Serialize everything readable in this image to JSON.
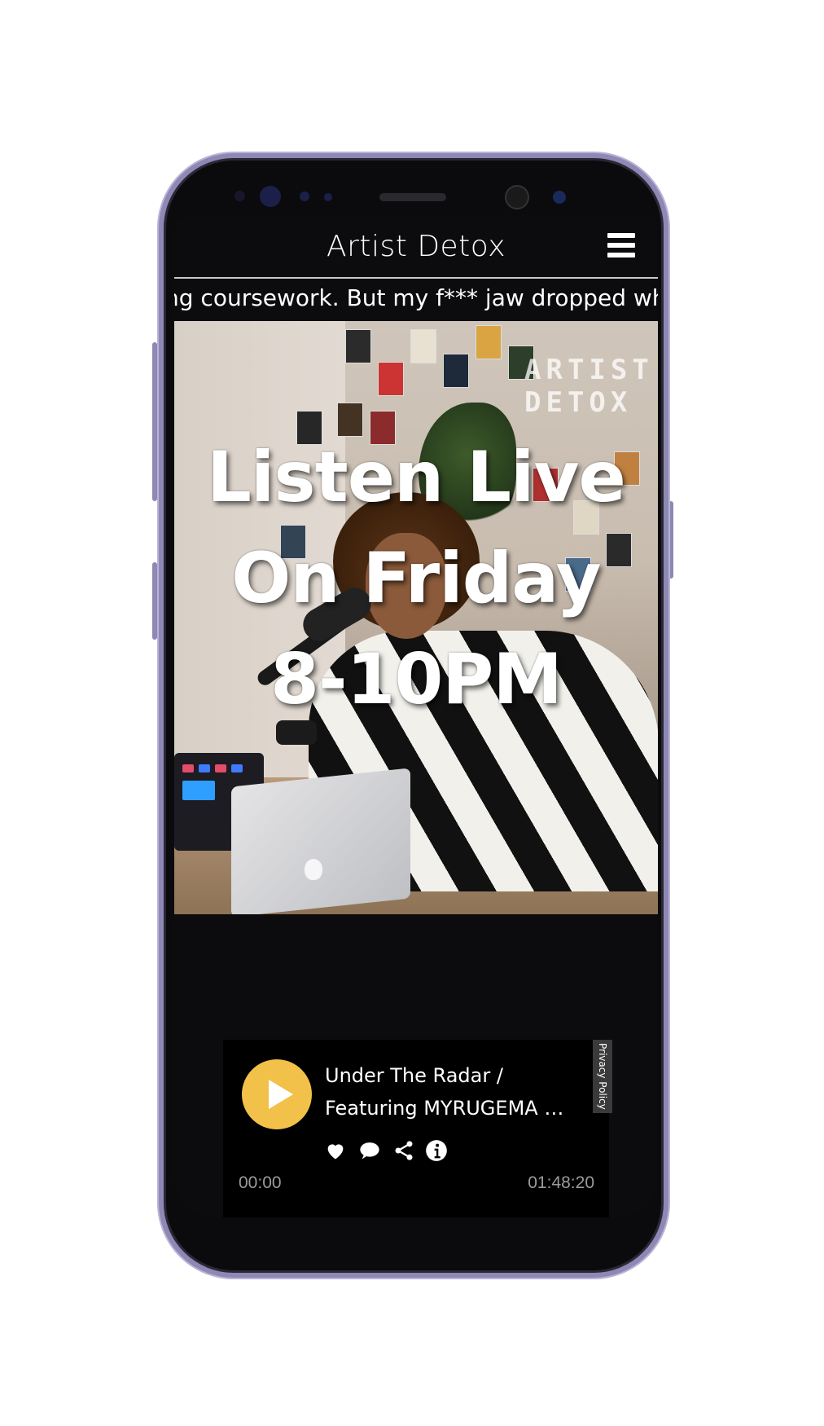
{
  "app": {
    "title": "Artist Detox",
    "ticker_text": "ng coursework. But my f*** jaw dropped wh"
  },
  "hero": {
    "headline": [
      "Listen Live",
      "On Friday",
      "8-10PM"
    ],
    "watermark": "ARTIST DETOX"
  },
  "player": {
    "track_title_line1": "Under The Radar /",
    "track_title_line2": "Featuring MYRUGEMA -...",
    "elapsed": "00:00",
    "duration": "01:48:20",
    "privacy_label": "Privacy Policy",
    "play_color": "#f2c14a",
    "actions": [
      "heart-icon",
      "comment-icon",
      "share-icon",
      "info-icon"
    ]
  }
}
